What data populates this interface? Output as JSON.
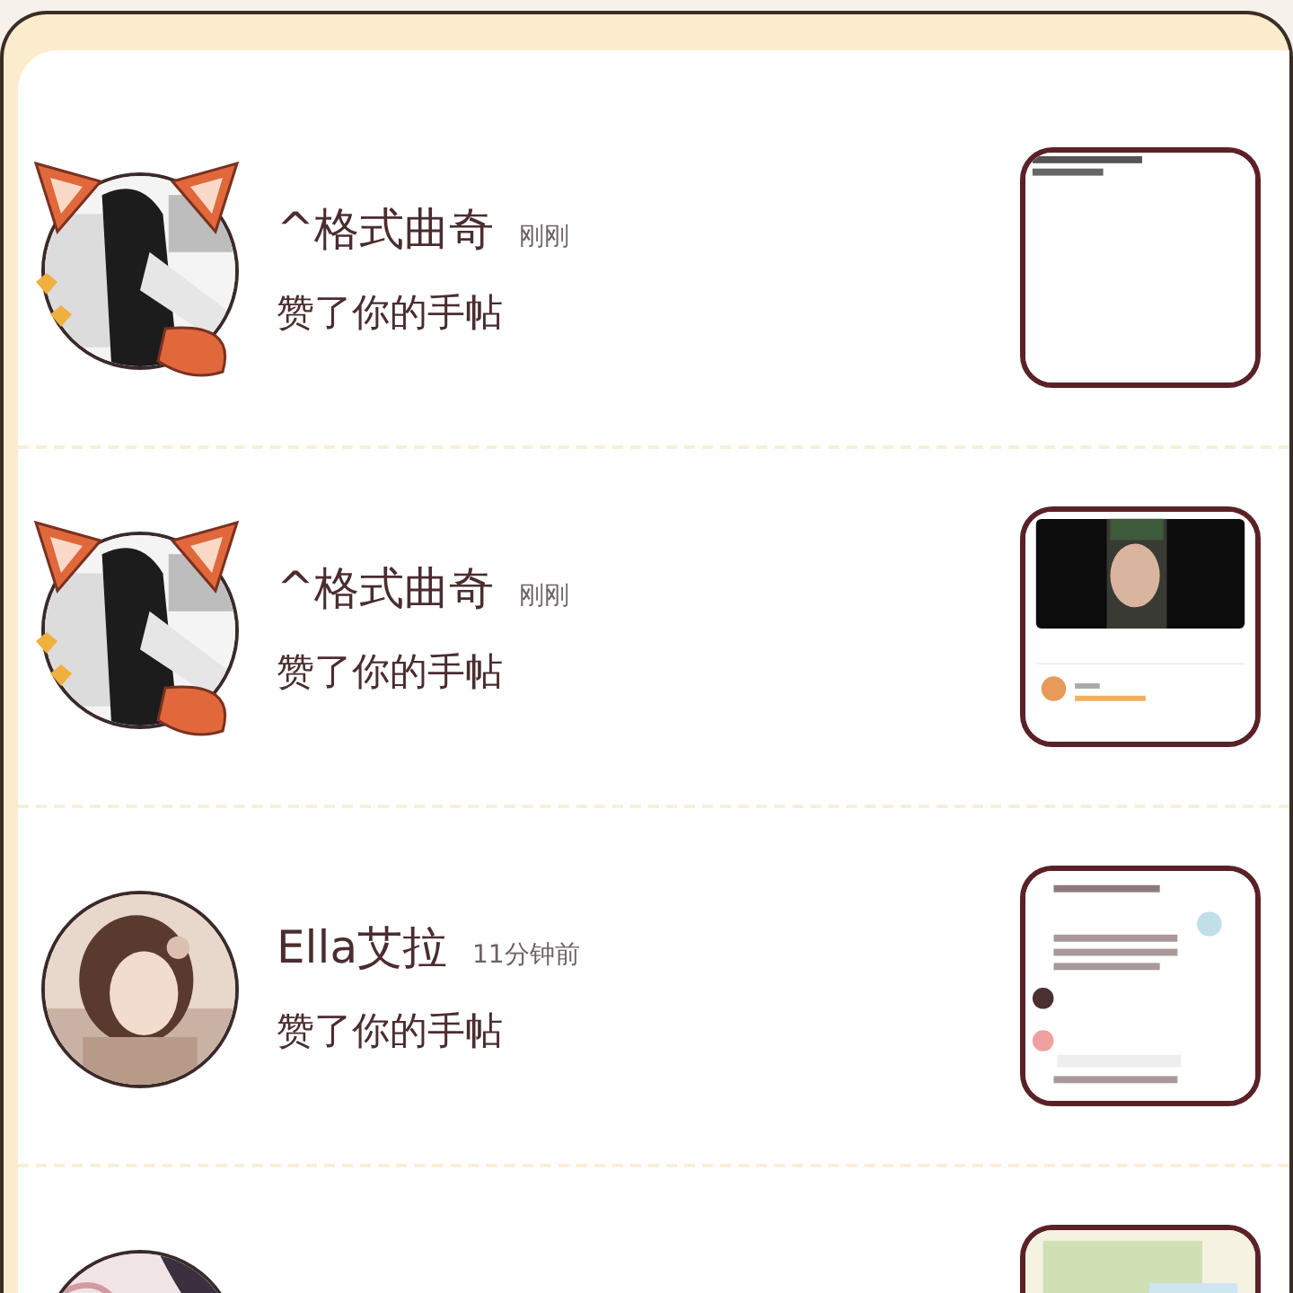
{
  "notifications": [
    {
      "name": "^格式曲奇",
      "time": "刚刚",
      "action": "赞了你的手帖",
      "avatar_frame": true
    },
    {
      "name": "^格式曲奇",
      "time": "刚刚",
      "action": "赞了你的手帖",
      "avatar_frame": true
    },
    {
      "name": "Ella艾拉",
      "time": "11分钟前",
      "action": "赞了你的手帖",
      "avatar_frame": false
    },
    {
      "avatar_frame": false
    }
  ]
}
